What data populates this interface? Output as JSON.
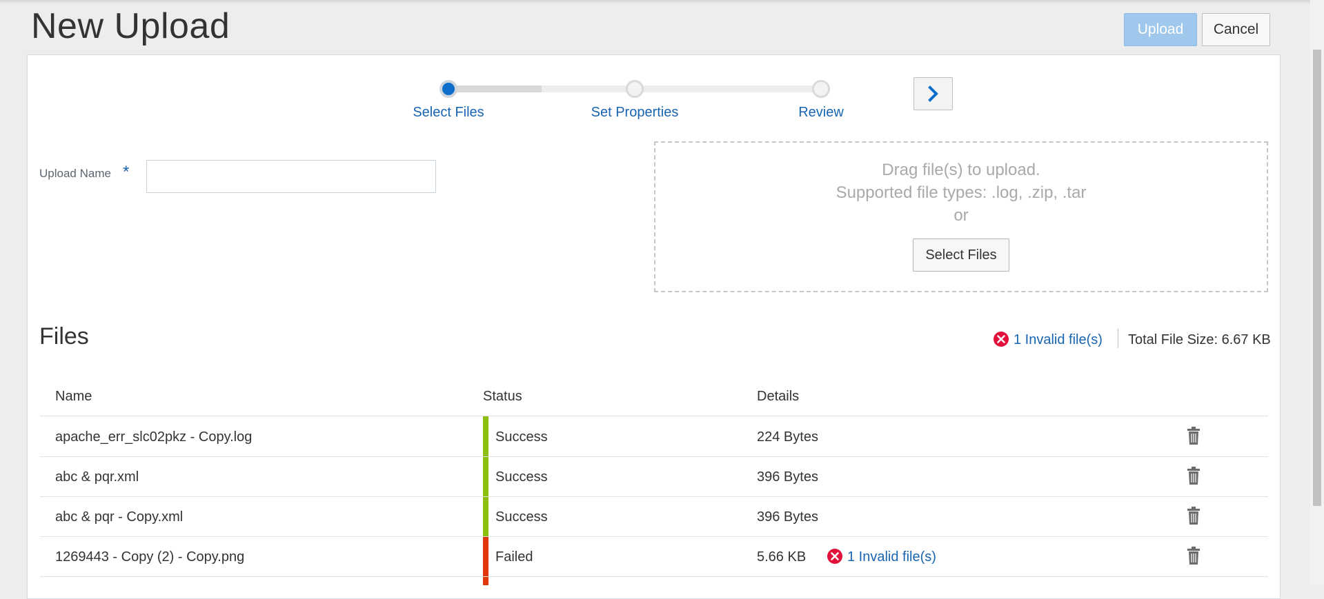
{
  "header": {
    "title": "New Upload",
    "upload_label": "Upload",
    "cancel_label": "Cancel"
  },
  "stepper": {
    "steps": [
      {
        "label": "Select Files",
        "state": "active"
      },
      {
        "label": "Set Properties",
        "state": "inactive"
      },
      {
        "label": "Review",
        "state": "inactive"
      }
    ],
    "next_icon": "chevron-right-icon"
  },
  "form": {
    "upload_name_label": "Upload Name",
    "required_marker": "*",
    "upload_name_value": ""
  },
  "dropzone": {
    "line1": "Drag file(s) to upload.",
    "line2": "Supported file types: .log, .zip, .tar",
    "line3": "or",
    "select_label": "Select Files"
  },
  "files": {
    "heading": "Files",
    "invalid_summary": "1 Invalid file(s)",
    "total_size": "Total File Size: 6.67 KB",
    "columns": [
      "Name",
      "Status",
      "Details"
    ],
    "rows": [
      {
        "name": "apache_err_slc02pkz - Copy.log",
        "status": "Success",
        "details": "224 Bytes",
        "invalid": ""
      },
      {
        "name": "abc & pqr.xml",
        "status": "Success",
        "details": "396 Bytes",
        "invalid": ""
      },
      {
        "name": "abc & pqr - Copy.xml",
        "status": "Success",
        "details": "396 Bytes",
        "invalid": ""
      },
      {
        "name": "1269443 - Copy (2) - Copy.png",
        "status": "Failed",
        "details": "5.66 KB",
        "invalid": "1 Invalid file(s)"
      }
    ]
  },
  "colors": {
    "success": "#8cbf10",
    "failed": "#e0360a",
    "error_icon": "#e0103a",
    "link": "#1864b0",
    "primary": "#0c6dcb"
  }
}
